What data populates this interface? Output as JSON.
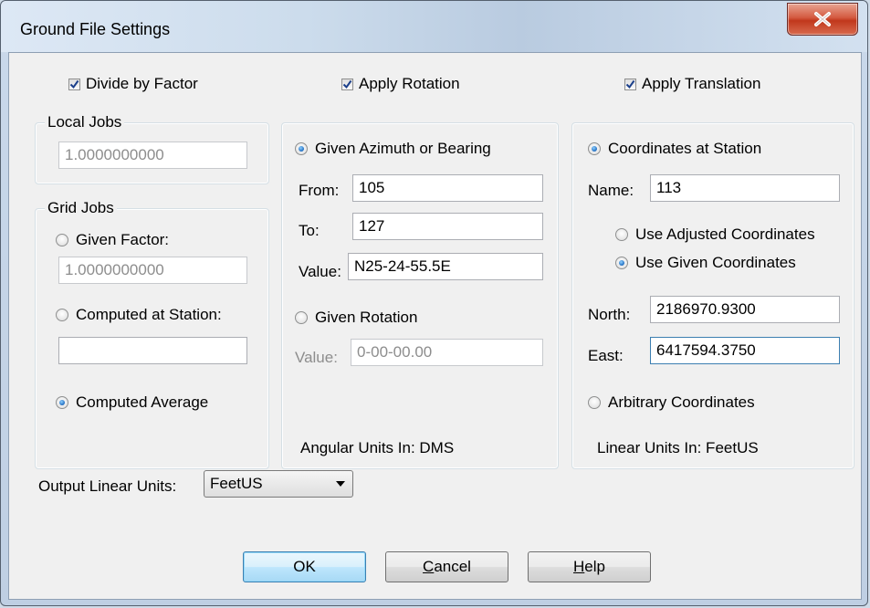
{
  "window": {
    "title": "Ground File Settings"
  },
  "top": {
    "divide_by_factor": {
      "label": "Divide by Factor",
      "checked": true
    },
    "apply_rotation": {
      "label": "Apply Rotation",
      "checked": true
    },
    "apply_translation": {
      "label": "Apply Translation",
      "checked": true
    }
  },
  "local_jobs": {
    "label": "Local Jobs",
    "value": "1.0000000000"
  },
  "grid_jobs": {
    "label": "Grid Jobs",
    "given_factor": {
      "label": "Given Factor:",
      "selected": false,
      "value": "1.0000000000"
    },
    "computed_at_station": {
      "label": "Computed at Station:",
      "selected": false,
      "value": ""
    },
    "computed_average": {
      "label": "Computed Average",
      "selected": true
    }
  },
  "rotation": {
    "given_azimuth": {
      "label": "Given Azimuth or Bearing",
      "selected": true
    },
    "from_label": "From:",
    "from_value": "105",
    "to_label": "To:",
    "to_value": "127",
    "value_label": "Value:",
    "value_value": "N25-24-55.5E",
    "given_rotation": {
      "label": "Given Rotation",
      "selected": false
    },
    "rot_value_label": "Value:",
    "rot_value_value": "0-00-00.00",
    "units_text": "Angular Units In: DMS"
  },
  "translation": {
    "coords_at_station": {
      "label": "Coordinates at Station",
      "selected": true
    },
    "name_label": "Name:",
    "name_value": "113",
    "use_adjusted": {
      "label": "Use Adjusted Coordinates",
      "selected": false
    },
    "use_given": {
      "label": "Use Given Coordinates",
      "selected": true
    },
    "north_label": "North:",
    "north_value": "2186970.9300",
    "east_label": "East:",
    "east_value": "6417594.3750",
    "arbitrary": {
      "label": "Arbitrary Coordinates",
      "selected": false
    },
    "units_text": "Linear Units In: FeetUS"
  },
  "output": {
    "label": "Output Linear Units:",
    "selected": "FeetUS"
  },
  "buttons": {
    "ok": "OK",
    "cancel_u": "C",
    "cancel_rest": "ancel",
    "help_u": "H",
    "help_rest": "elp"
  },
  "colors": {
    "accent": "#3c7fb1",
    "close": "#c1381c"
  }
}
